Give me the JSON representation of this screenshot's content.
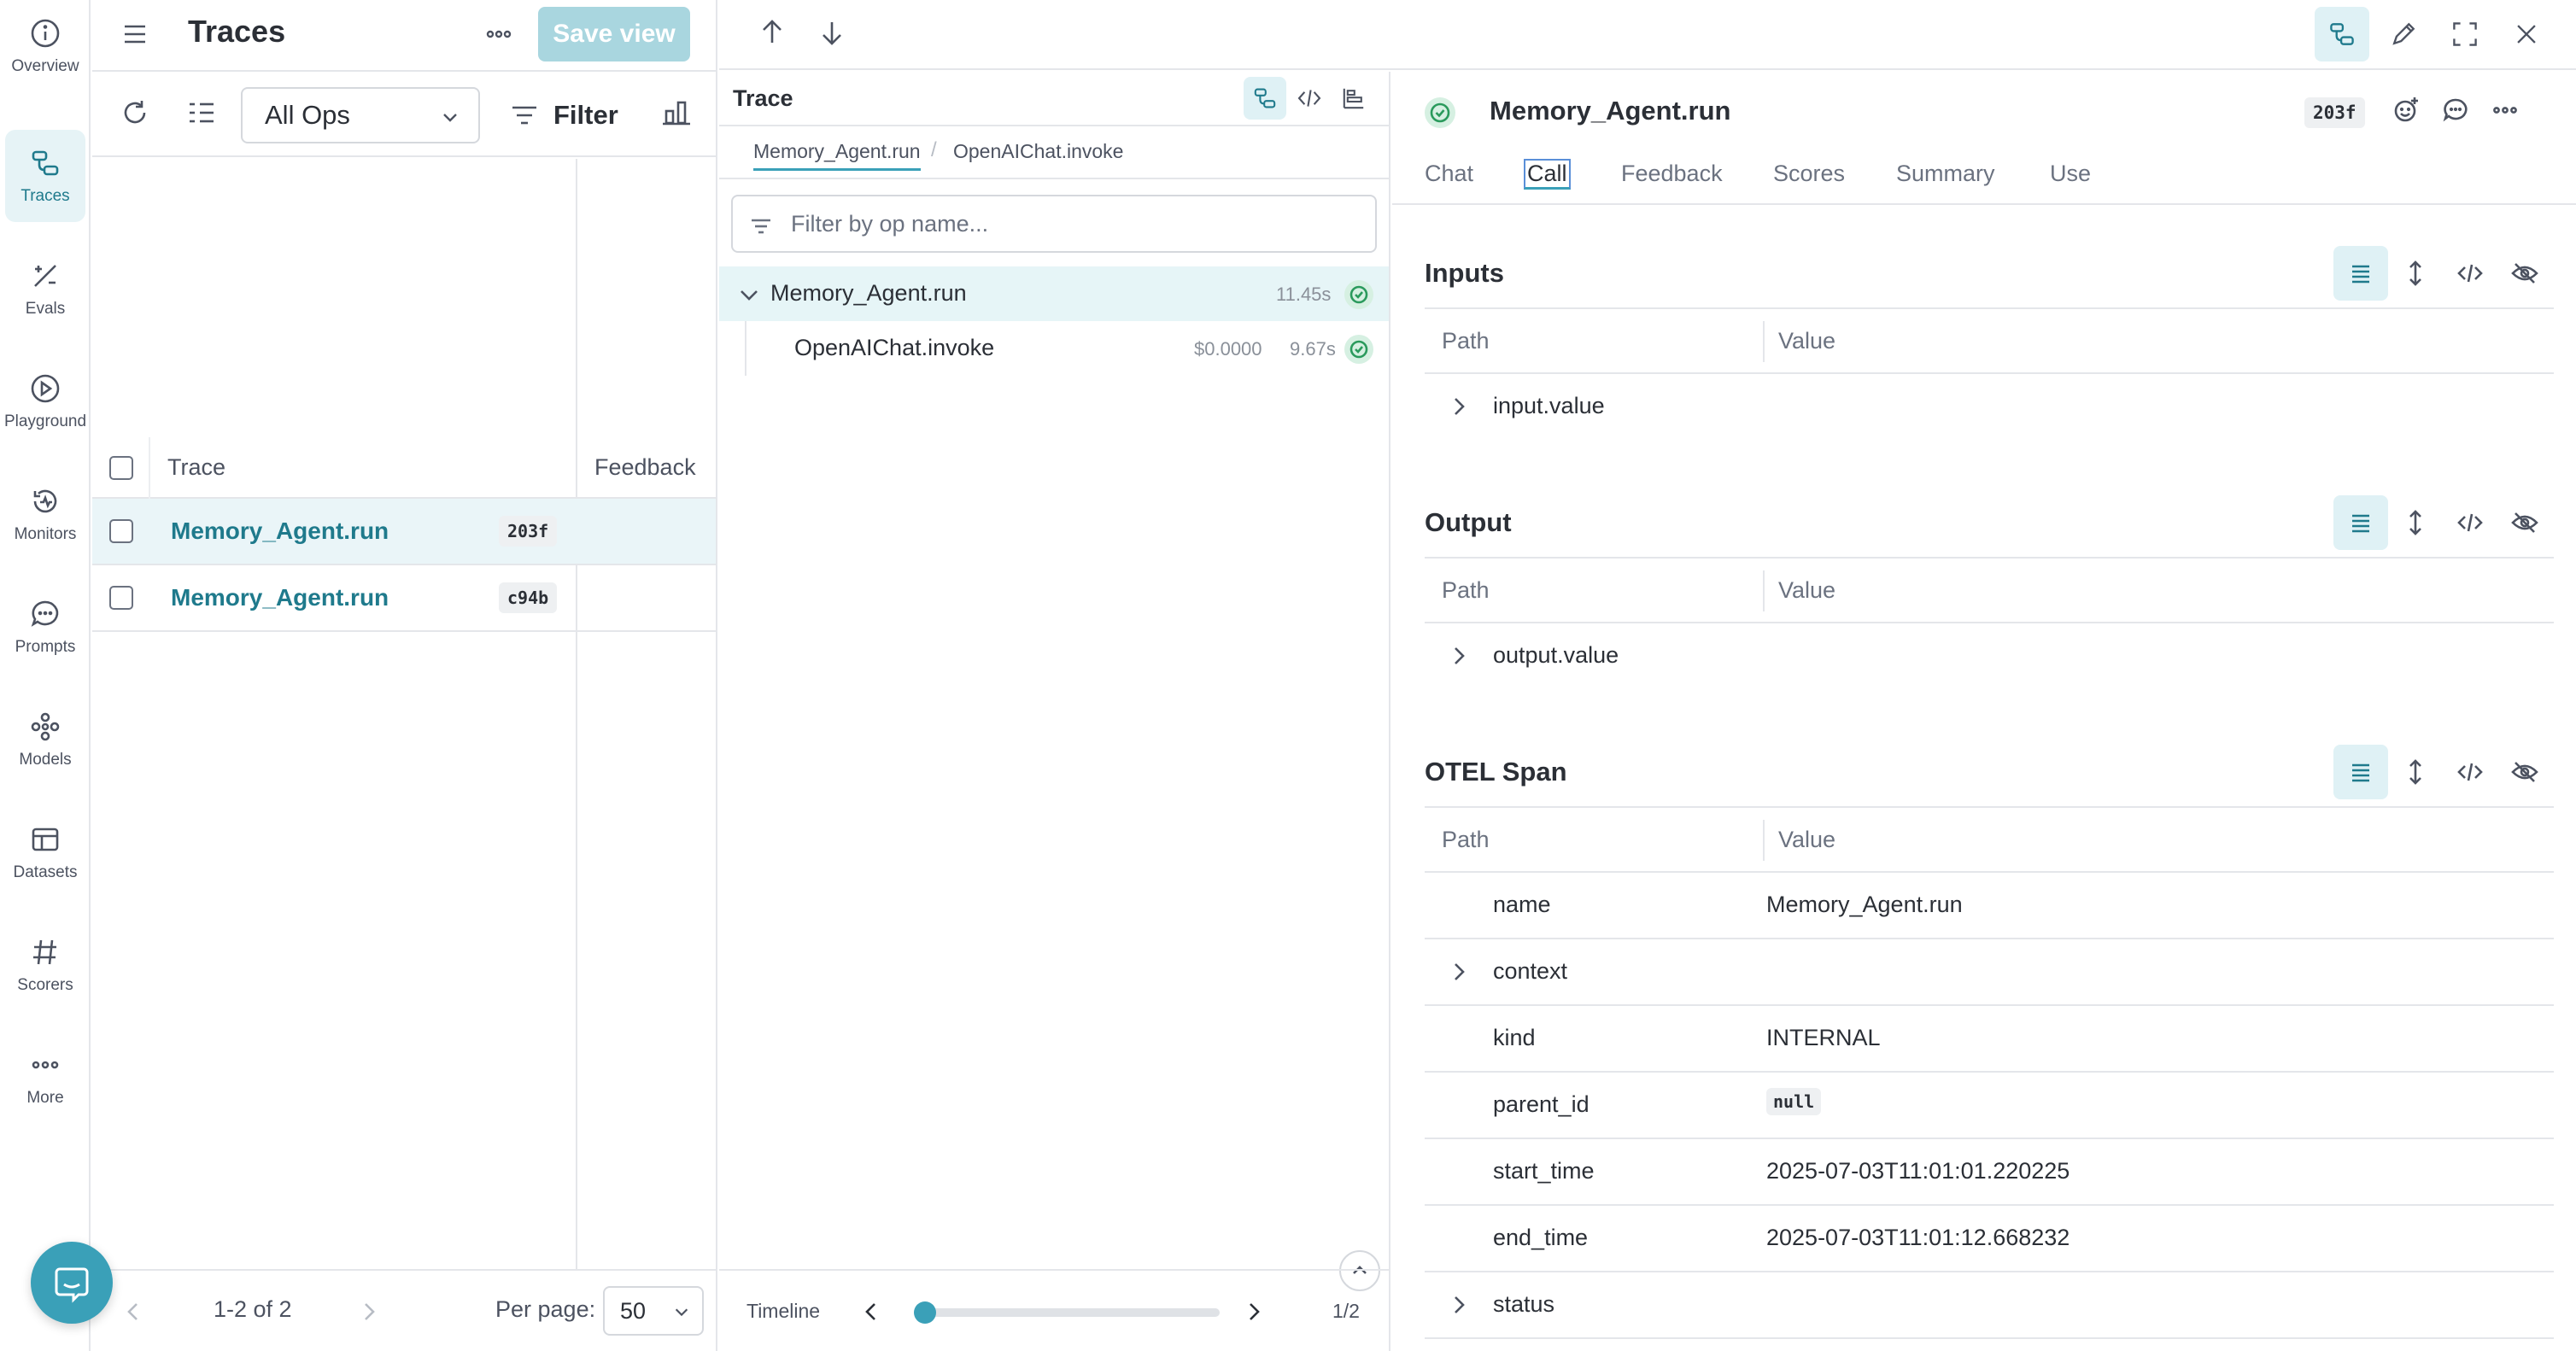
{
  "rail": {
    "items": [
      {
        "label": "Overview",
        "icon": "info-icon"
      },
      {
        "label": "Traces",
        "icon": "traces-icon",
        "active": true
      },
      {
        "label": "Evals",
        "icon": "evals-icon"
      },
      {
        "label": "Playground",
        "icon": "playground-icon"
      },
      {
        "label": "Monitors",
        "icon": "monitor-icon"
      },
      {
        "label": "Prompts",
        "icon": "prompt-icon"
      },
      {
        "label": "Models",
        "icon": "models-icon"
      },
      {
        "label": "Datasets",
        "icon": "dataset-icon"
      },
      {
        "label": "Scorers",
        "icon": "hash-icon"
      },
      {
        "label": "More",
        "icon": "more-icon"
      }
    ]
  },
  "traces": {
    "title": "Traces",
    "save_view": "Save view",
    "ops_select": "All Ops",
    "filter_label": "Filter",
    "columns": {
      "trace": "Trace",
      "feedback": "Feedback"
    },
    "rows": [
      {
        "name": "Memory_Agent.run",
        "badge": "203f",
        "selected": true
      },
      {
        "name": "Memory_Agent.run",
        "badge": "c94b",
        "selected": false
      }
    ],
    "pagination": {
      "count": "1-2 of 2",
      "per_page_label": "Per page:",
      "per_page_value": "50"
    }
  },
  "tree": {
    "title": "Trace",
    "breadcrumb": [
      "Memory_Agent.run",
      "OpenAIChat.invoke"
    ],
    "filter_placeholder": "Filter by op name...",
    "nodes": [
      {
        "name": "Memory_Agent.run",
        "duration": "11.45s",
        "cost": "",
        "selected": true
      },
      {
        "name": "OpenAIChat.invoke",
        "duration": "9.67s",
        "cost": "$0.0000",
        "selected": false
      }
    ],
    "timeline": {
      "label": "Timeline",
      "count": "1/2",
      "position": 0.0
    }
  },
  "detail": {
    "title": "Memory_Agent.run",
    "badge": "203f",
    "tabs": [
      "Chat",
      "Call",
      "Feedback",
      "Scores",
      "Summary",
      "Use"
    ],
    "active_tab": "Call",
    "headers": {
      "path": "Path",
      "value": "Value"
    },
    "inputs": {
      "title": "Inputs",
      "rows": [
        {
          "key": "input.value",
          "value": "",
          "expandable": true
        }
      ]
    },
    "output": {
      "title": "Output",
      "rows": [
        {
          "key": "output.value",
          "value": "",
          "expandable": true
        }
      ]
    },
    "otel": {
      "title": "OTEL Span",
      "rows": [
        {
          "key": "name",
          "value": "Memory_Agent.run",
          "expandable": false
        },
        {
          "key": "context",
          "value": "",
          "expandable": true
        },
        {
          "key": "kind",
          "value": "INTERNAL",
          "expandable": false
        },
        {
          "key": "parent_id",
          "value": "null",
          "expandable": false,
          "code": true
        },
        {
          "key": "start_time",
          "value": "2025-07-03T11:01:01.220225",
          "expandable": false
        },
        {
          "key": "end_time",
          "value": "2025-07-03T11:01:12.668232",
          "expandable": false
        },
        {
          "key": "status",
          "value": "",
          "expandable": true
        }
      ]
    }
  },
  "colors": {
    "accent": "#1f7a8c",
    "accent_light": "#dff1f5",
    "success": "#2a9a5c",
    "save_button": "#a9d6df"
  }
}
